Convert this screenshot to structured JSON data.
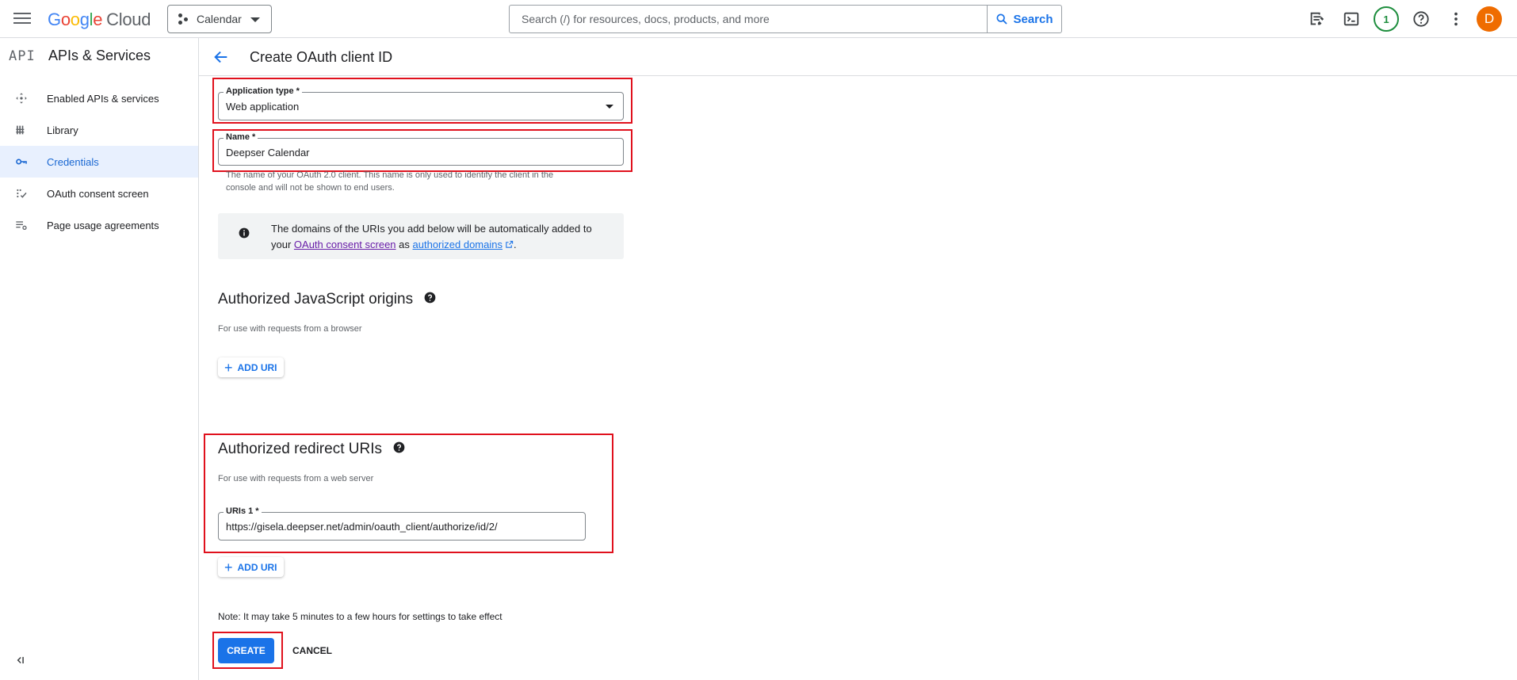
{
  "topbar": {
    "logo_text": "Google Cloud",
    "project_name": "Calendar",
    "search_placeholder": "Search (/) for resources, docs, products, and more",
    "search_button": "Search",
    "notification_count": "1",
    "avatar_initial": "D"
  },
  "sidebar": {
    "title": "APIs & Services",
    "logo": "API",
    "items": [
      {
        "label": "Enabled APIs & services",
        "icon": "enabled-apis-icon"
      },
      {
        "label": "Library",
        "icon": "library-icon"
      },
      {
        "label": "Credentials",
        "icon": "key-icon",
        "active": true
      },
      {
        "label": "OAuth consent screen",
        "icon": "consent-icon"
      },
      {
        "label": "Page usage agreements",
        "icon": "settings-list-icon"
      }
    ],
    "collapse_glyph": "<I"
  },
  "page": {
    "title": "Create OAuth client ID"
  },
  "form": {
    "app_type": {
      "label": "Application type *",
      "value": "Web application"
    },
    "name": {
      "label": "Name *",
      "value": "Deepser Calendar"
    },
    "name_hint_line1": "The name of your OAuth 2.0 client. This name is only used to identify the client in the",
    "name_hint_line2": "console and will not be shown to end users.",
    "info": {
      "line1": "The domains of the URIs you add below will be automatically added to",
      "line2_prefix": "your ",
      "link1": "OAuth consent screen",
      "between": " as ",
      "link2": "authorized domains",
      "suffix": "."
    },
    "js_origins": {
      "title": "Authorized JavaScript origins",
      "subtitle": "For use with requests from a browser",
      "add_label": "ADD URI"
    },
    "redirect_uris": {
      "title": "Authorized redirect URIs",
      "subtitle": "For use with requests from a web server",
      "uri_label": "URIs 1 *",
      "uri_value": "https://gisela.deepser.net/admin/oauth_client/authorize/id/2/",
      "add_label": "ADD URI"
    },
    "note": "Note: It may take 5 minutes to a few hours for settings to take effect",
    "create_label": "CREATE",
    "cancel_label": "CANCEL"
  },
  "colors": {
    "accent": "#1a73e8",
    "highlight_box": "#e0111d",
    "active_nav_bg": "#e8f0fe"
  }
}
